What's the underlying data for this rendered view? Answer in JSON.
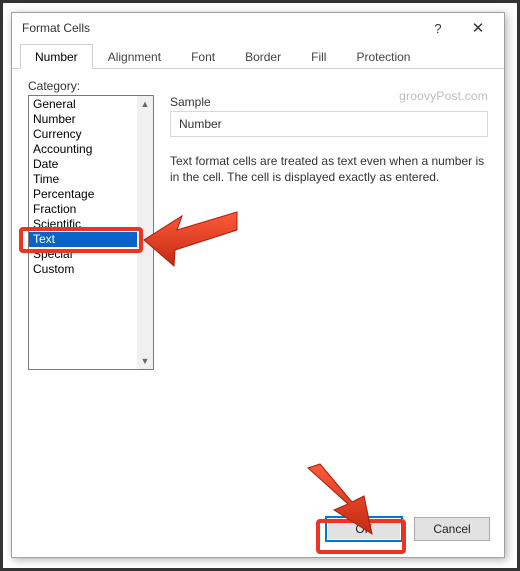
{
  "dialog": {
    "title": "Format Cells",
    "help_tooltip": "?",
    "close_tooltip": "✕"
  },
  "tabs": {
    "number": "Number",
    "alignment": "Alignment",
    "font": "Font",
    "border": "Border",
    "fill": "Fill",
    "protection": "Protection"
  },
  "category": {
    "label": "Category:",
    "items": [
      "General",
      "Number",
      "Currency",
      "Accounting",
      "Date",
      "Time",
      "Percentage",
      "Fraction",
      "Scientific",
      "Text",
      "Special",
      "Custom"
    ],
    "selected_index": 9
  },
  "sample": {
    "label": "Sample",
    "value": "Number"
  },
  "description": "Text format cells are treated as text even when a number is in the cell. The cell is displayed exactly as entered.",
  "watermark": "groovyPost.com",
  "buttons": {
    "ok": "OK",
    "cancel": "Cancel"
  }
}
